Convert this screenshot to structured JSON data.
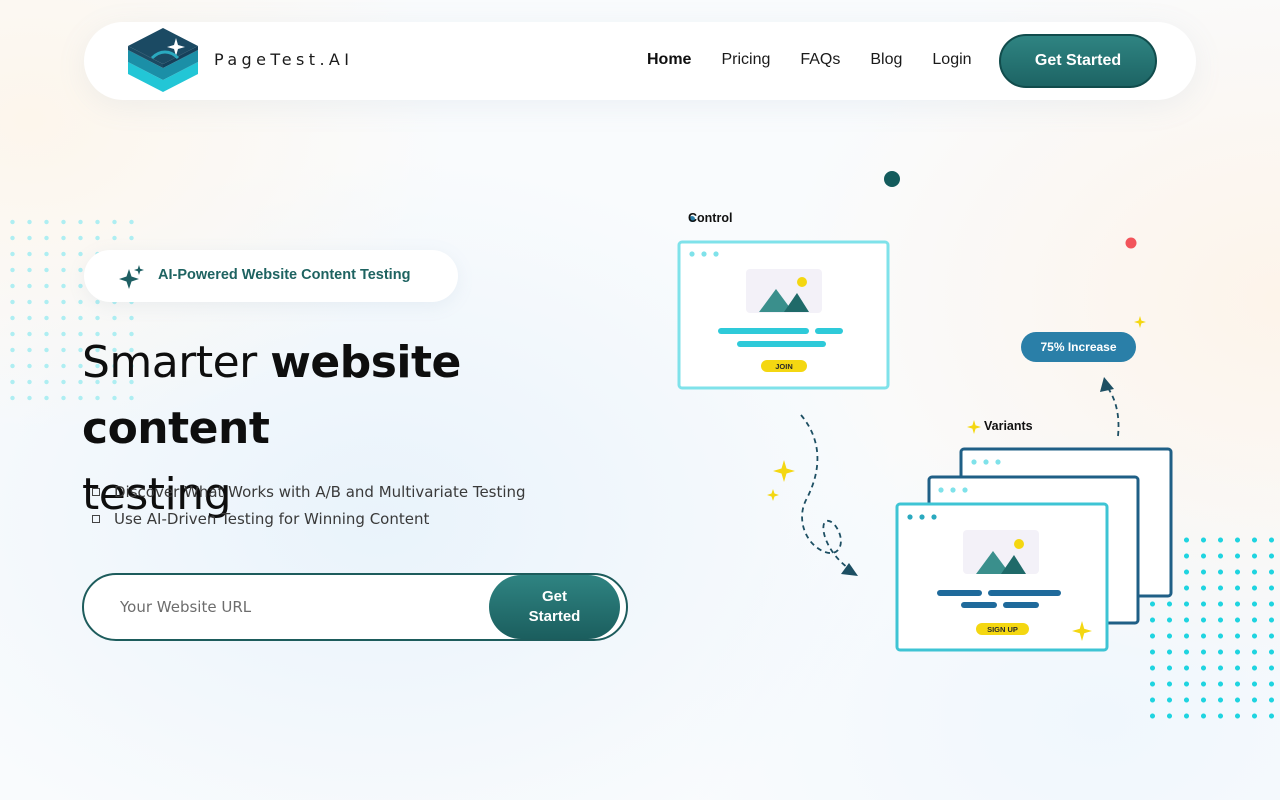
{
  "brand": {
    "name": "PageTest.AI"
  },
  "nav": {
    "items": [
      {
        "label": "Home",
        "active": true
      },
      {
        "label": "Pricing",
        "active": false
      },
      {
        "label": "FAQs",
        "active": false
      },
      {
        "label": "Blog",
        "active": false
      },
      {
        "label": "Login",
        "active": false
      }
    ],
    "cta_label": "Get Started"
  },
  "hero": {
    "badge_text": "AI-Powered Website Content Testing",
    "headline_light": "Smarter ",
    "headline_bold": "website content",
    "headline_line2": "testing",
    "features": [
      "Discover What Works with A/B and Multivariate Testing",
      "Use AI-Driven Testing for Winning Content"
    ],
    "url_input": {
      "placeholder": "Your Website URL",
      "value": ""
    },
    "url_button_label": "Get Started"
  },
  "illustration": {
    "control_label": "Control",
    "variants_label": "Variants",
    "increase_label": "75% Increase",
    "join_label": "JOIN",
    "signup_label": "SIGN UP"
  },
  "colors": {
    "primary": "#1f6a69",
    "accent_cyan": "#22d3e0",
    "navy": "#1f5f86",
    "yellow": "#f4d711",
    "red": "#f2545b"
  }
}
